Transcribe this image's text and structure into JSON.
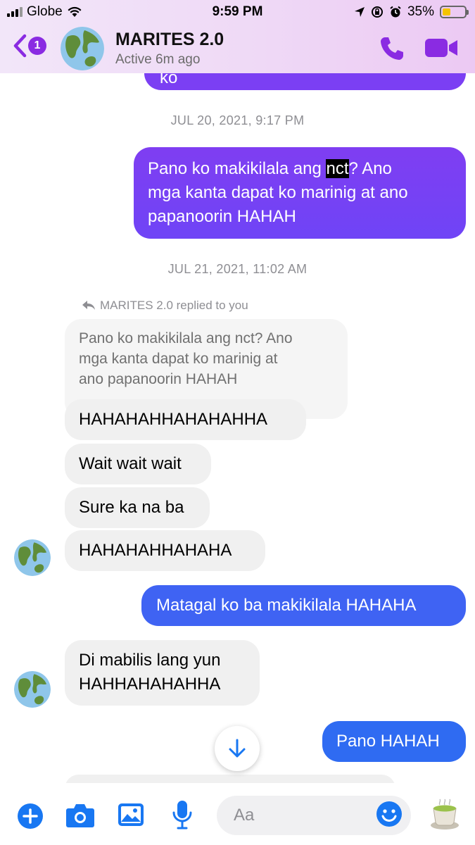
{
  "status_bar": {
    "carrier": "Globe",
    "time": "9:59 PM",
    "battery": "35%"
  },
  "header": {
    "back_badge": "1",
    "contact_name": "MARITES 2.0",
    "contact_status": "Active 6m ago"
  },
  "messages": {
    "top_partial": "ko",
    "stamp_1": "JUL 20, 2021, 9:17 PM",
    "out_1": {
      "line1_before": "Pano ko makikilala ang ",
      "line1_highlight": "nct",
      "line1_after": "? Ano",
      "line2": "mga kanta dapat ko marinig at ano",
      "line3": "papanoorin HAHAH"
    },
    "stamp_2": "JUL 21, 2021, 11:02 AM",
    "replied_label": "MARITES 2.0 replied to you",
    "quote": {
      "line1": "Pano ko makikilala ang nct? Ano",
      "line2": "mga kanta dapat ko marinig at",
      "line3": "ano papanoorin HAHAH"
    },
    "in_1": "HAHAHAHHAHAHAHHA",
    "in_2": "Wait wait wait",
    "in_3": "Sure ka na ba",
    "in_4": "HAHAHAHHAHAHA",
    "out_2": "Matagal ko ba makikilala HAHAHA",
    "in_5": {
      "line1": "Di mabilis lang yun",
      "line2": "HAHHAHAHAHHA"
    },
    "out_3": "Pano HAHAH"
  },
  "composer": {
    "placeholder": "Aa"
  },
  "colors": {
    "accent": "#8a2be2",
    "bubble_purple": "#7b3ff3",
    "bubble_blue": "#2f6bf2",
    "icon_blue": "#1877f2"
  },
  "icons": [
    "back-icon",
    "earth-avatar",
    "phone-icon",
    "video-icon",
    "reply-arrow-icon",
    "arrow-down-icon",
    "plus-icon",
    "camera-icon",
    "gallery-icon",
    "mic-icon",
    "emoji-icon",
    "tea-icon"
  ]
}
